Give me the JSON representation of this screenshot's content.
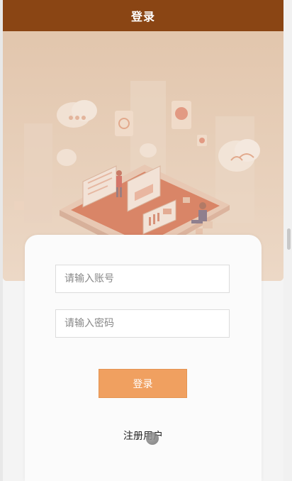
{
  "header": {
    "title": "登录"
  },
  "form": {
    "account_placeholder": "请输入账号",
    "password_placeholder": "请输入密码",
    "login_label": "登录",
    "register_label": "注册用户"
  },
  "colors": {
    "header_bg": "#8a4514",
    "hero_bg": "#e6cdb6",
    "button_bg": "#f0a060"
  },
  "icons": {
    "hero": "isometric-office-illustration",
    "cursor": "pointer-cursor-icon"
  }
}
